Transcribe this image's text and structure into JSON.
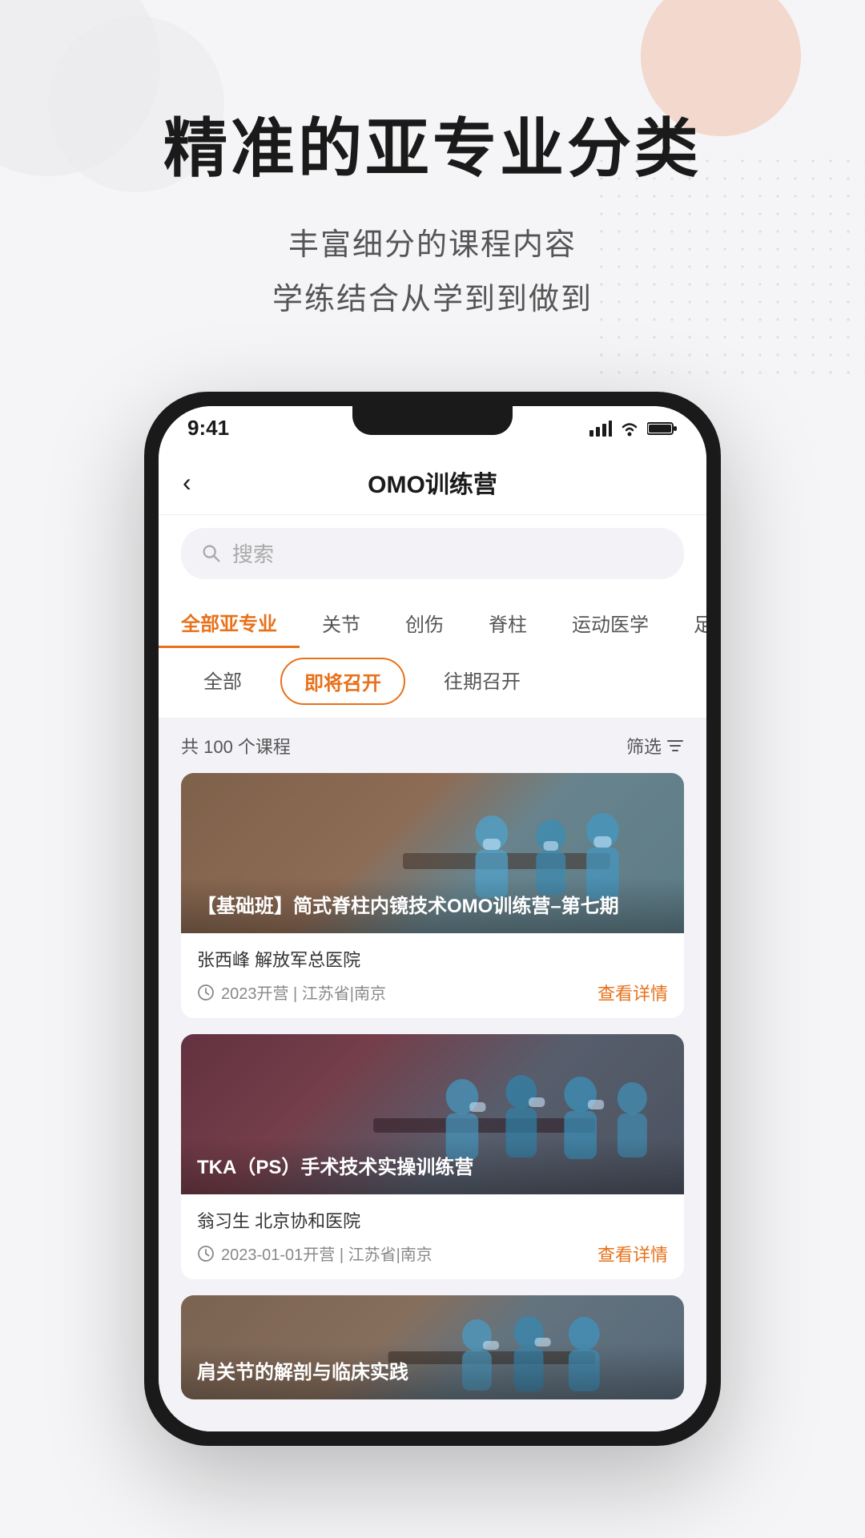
{
  "hero": {
    "title": "精准的亚专业分类",
    "subtitle_line1": "丰富细分的课程内容",
    "subtitle_line2": "学练结合从学到到做到"
  },
  "phone": {
    "status_time": "9:41",
    "nav_title": "OMO训练营",
    "nav_back": "‹",
    "search_placeholder": "搜索",
    "categories": [
      {
        "label": "全部亚专业",
        "active": true
      },
      {
        "label": "关节",
        "active": false
      },
      {
        "label": "创伤",
        "active": false
      },
      {
        "label": "脊柱",
        "active": false
      },
      {
        "label": "运动医学",
        "active": false
      },
      {
        "label": "足跖",
        "active": false
      }
    ],
    "sub_filters": [
      {
        "label": "全部",
        "active": false
      },
      {
        "label": "即将召开",
        "active": true
      },
      {
        "label": "往期召开",
        "active": false
      }
    ],
    "count_text": "共 100 个课程",
    "filter_label": "筛选",
    "courses": [
      {
        "title": "【基础班】简式脊柱内镜技术OMO训练营–第七期",
        "author": "张西峰  解放军总医院",
        "time": "2023开营 | 江苏省|南京",
        "link": "查看详情",
        "img_type": "surgery1"
      },
      {
        "title": "TKA（PS）手术技术实操训练营",
        "author": "翁习生  北京协和医院",
        "time": "2023-01-01开营 | 江苏省|南京",
        "link": "查看详情",
        "img_type": "surgery2"
      },
      {
        "title": "肩关节的解剖与临床实践",
        "author": "",
        "time": "",
        "link": "",
        "img_type": "surgery3"
      }
    ]
  }
}
